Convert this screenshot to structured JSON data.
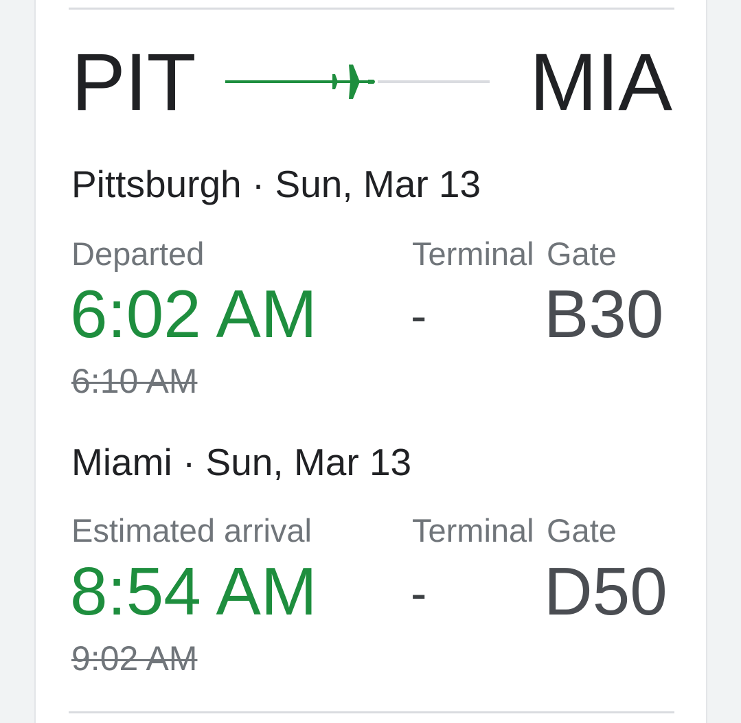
{
  "route": {
    "origin_code": "PIT",
    "destination_code": "MIA",
    "progress": 0.55,
    "accent_color": "#1e8e3e",
    "icon": "airplane-icon"
  },
  "departure": {
    "city_line": "Pittsburgh · Sun, Mar 13",
    "status_label": "Departed",
    "actual_time": "6:02 AM",
    "scheduled_time": "6:10 AM",
    "terminal_label": "Terminal",
    "terminal_value": "-",
    "gate_label": "Gate",
    "gate_value": "B30"
  },
  "arrival": {
    "city_line": "Miami · Sun, Mar 13",
    "status_label": "Estimated arrival",
    "actual_time": "8:54 AM",
    "scheduled_time": "9:02 AM",
    "terminal_label": "Terminal",
    "terminal_value": "-",
    "gate_label": "Gate",
    "gate_value": "D50"
  }
}
